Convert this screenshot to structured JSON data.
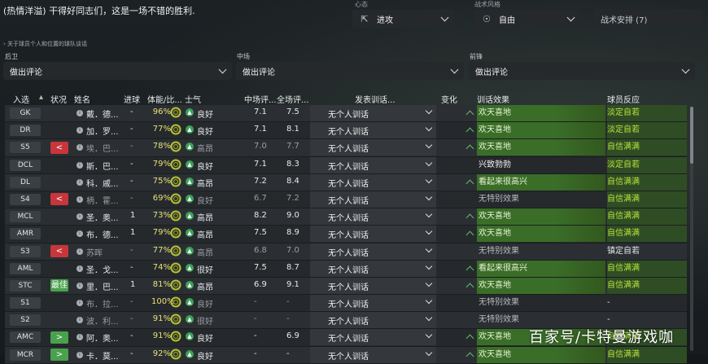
{
  "header_message": "(热情洋溢) 干得好同志们，这是一场不错的胜利.",
  "top_controls": {
    "left_label": "心态",
    "right_label": "战术风格",
    "mentality_value": "进攻",
    "style_value": "自由",
    "tactic_button": "战术安排 (7)"
  },
  "note_text": "关于球员个人和位置的球队谈话",
  "groups": [
    {
      "label": "后卫",
      "value": "做出评论"
    },
    {
      "label": "中场",
      "value": "做出评论"
    },
    {
      "label": "前锋",
      "value": "做出评论"
    }
  ],
  "columns": {
    "sel": "入选",
    "status": "状况",
    "name": "姓名",
    "goals": "进球",
    "fitness": "体能/比...",
    "morale": "士气",
    "mid_rating": "中场评...",
    "full_rating": "全场评...",
    "talk": "发表训话...",
    "change": "变化",
    "effect": "训话效果",
    "reaction": "球员反应"
  },
  "players": [
    {
      "pos": "GK",
      "badge": "",
      "name": "戴．德...",
      "goals": "-",
      "fit": "96%",
      "morale": "良好",
      "mid": "7.1",
      "full": "7.5",
      "talk": "无个人训话",
      "effect": "欢天喜地",
      "effect_style": "g",
      "reaction": "淡定自若",
      "reaction_style": "g",
      "dim": false
    },
    {
      "pos": "DR",
      "badge": "",
      "name": "加．罗...",
      "goals": "-",
      "fit": "77%",
      "morale": "良好",
      "mid": "7.1",
      "full": "8.1",
      "talk": "无个人训话",
      "effect": "欢天喜地",
      "effect_style": "g",
      "reaction": "淡定自若",
      "reaction_style": "g",
      "dim": false
    },
    {
      "pos": "S5",
      "badge": "<",
      "name": "埃．巴...",
      "goals": "-",
      "fit": "78%",
      "morale": "高昂",
      "mid": "7.0",
      "full": "7.7",
      "talk": "无个人训话",
      "effect": "欢天喜地",
      "effect_style": "g",
      "reaction": "自信满满",
      "reaction_style": "g",
      "dim": true
    },
    {
      "pos": "DCL",
      "badge": "",
      "name": "斯．巴...",
      "goals": "-",
      "fit": "79%",
      "morale": "良好",
      "mid": "7.1",
      "full": "8.3",
      "talk": "无个人训话",
      "effect": "兴致勃勃",
      "effect_style": "w",
      "reaction": "淡定自若",
      "reaction_style": "g",
      "dim": false
    },
    {
      "pos": "DL",
      "badge": "",
      "name": "科．戚...",
      "goals": "-",
      "fit": "75%",
      "morale": "高昂",
      "mid": "7.2",
      "full": "8.4",
      "talk": "无个人训话",
      "effect": "看起来很高兴",
      "effect_style": "g",
      "reaction": "自信满满",
      "reaction_style": "g",
      "dim": false
    },
    {
      "pos": "S4",
      "badge": "<",
      "name": "柄．霍...",
      "goals": "-",
      "fit": "69%",
      "morale": "良好",
      "mid": "6.7",
      "full": "7.2",
      "talk": "无个人训话",
      "effect": "无特别效果",
      "effect_style": "n",
      "reaction": "自信满满",
      "reaction_style": "g",
      "dim": true
    },
    {
      "pos": "MCL",
      "badge": "",
      "name": "圣．奥...",
      "goals": "1",
      "fit": "73%",
      "morale": "高昂",
      "mid": "8.2",
      "full": "9.0",
      "talk": "无个人训话",
      "effect": "欢天喜地",
      "effect_style": "g",
      "reaction": "自信满满",
      "reaction_style": "g",
      "dim": false
    },
    {
      "pos": "AMR",
      "badge": "",
      "name": "布．德...",
      "goals": "1",
      "fit": "79%",
      "morale": "高昂",
      "mid": "7.5",
      "full": "8.9",
      "talk": "无个人训话",
      "effect": "欢天喜地",
      "effect_style": "g",
      "reaction": "自信满满",
      "reaction_style": "g",
      "dim": false
    },
    {
      "pos": "S3",
      "badge": "<",
      "name": "苏晖",
      "goals": "-",
      "fit": "77%",
      "morale": "高昂",
      "mid": "6.8",
      "full": "7.0",
      "talk": "无个人训话",
      "effect": "无特别效果",
      "effect_style": "n",
      "reaction": "镇定自若",
      "reaction_style": "n",
      "dim": true
    },
    {
      "pos": "AML",
      "badge": "",
      "name": "圣．戈...",
      "goals": "-",
      "fit": "74%",
      "morale": "很好",
      "mid": "7.5",
      "full": "8.7",
      "talk": "无个人训话",
      "effect": "看起来很高兴",
      "effect_style": "g",
      "reaction": "自信满满",
      "reaction_style": "g",
      "dim": false
    },
    {
      "pos": "STC",
      "badge": "最佳",
      "name": "里．巴...",
      "goals": "1",
      "fit": "81%",
      "morale": "高昂",
      "mid": "6.9",
      "full": "9.1",
      "talk": "无个人训话",
      "effect": "欢天喜地",
      "effect_style": "g",
      "reaction": "自信满满",
      "reaction_style": "g",
      "dim": false
    },
    {
      "pos": "S1",
      "badge": "",
      "name": "布．拉...",
      "goals": "-",
      "fit": "100%",
      "morale": "良好",
      "mid": "-",
      "full": "-",
      "talk": "无个人训话",
      "effect": "无特别效果",
      "effect_style": "n",
      "reaction": "-",
      "reaction_style": "n",
      "dim": true
    },
    {
      "pos": "S2",
      "badge": "",
      "name": "波．利...",
      "goals": "-",
      "fit": "91%",
      "morale": "很好",
      "mid": "-",
      "full": "-",
      "talk": "无个人训话",
      "effect": "无特别效果",
      "effect_style": "n",
      "reaction": "-",
      "reaction_style": "n",
      "dim": true
    },
    {
      "pos": "AMC",
      "badge": ">",
      "name": "阿．奥...",
      "goals": "-",
      "fit": "91%",
      "morale": "良好",
      "mid": "-",
      "full": "6.9",
      "talk": "无个人训话",
      "effect": "欢天喜地",
      "effect_style": "g",
      "reaction": "自信满满",
      "reaction_style": "g",
      "dim": false
    },
    {
      "pos": "MCR",
      "badge": ">",
      "name": "卡．莫...",
      "goals": "-",
      "fit": "92%",
      "morale": "良好",
      "mid": "-",
      "full": "-",
      "talk": "无个人训话",
      "effect": "欢天喜地",
      "effect_style": "g",
      "reaction": "自信满满",
      "reaction_style": "g",
      "dim": false
    }
  ],
  "watermark": "百家号/卡特曼游戏咖"
}
